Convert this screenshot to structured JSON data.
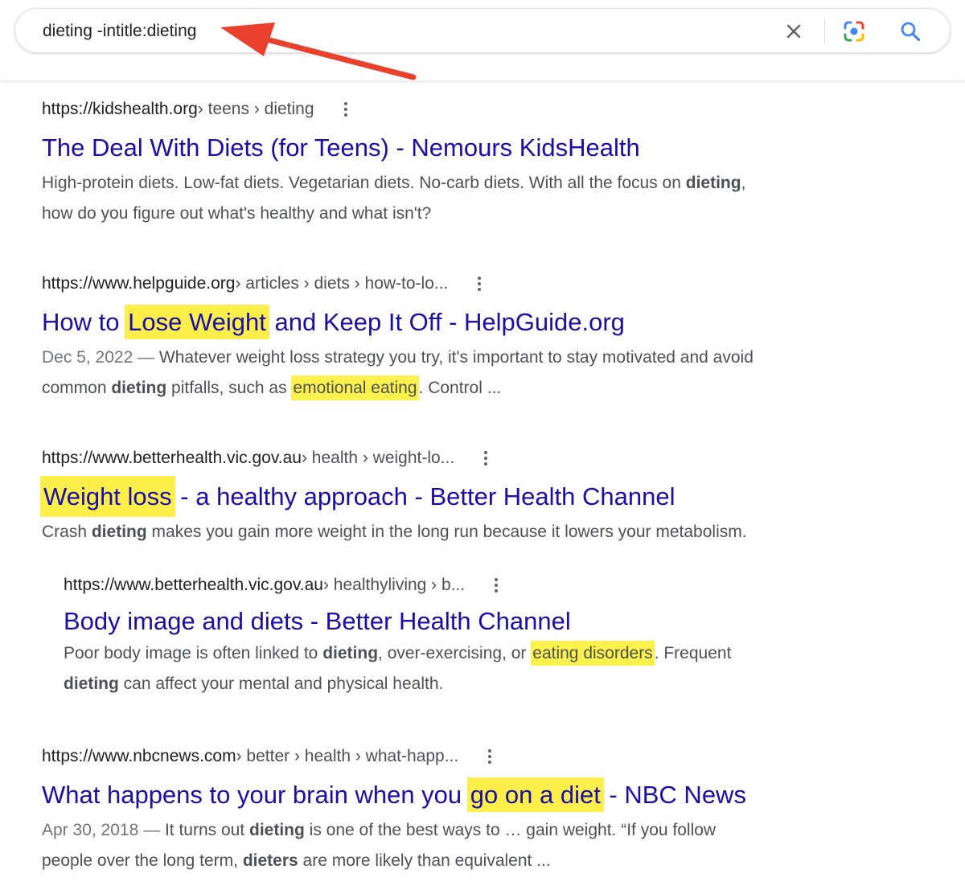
{
  "search": {
    "query": "dieting -intitle:dieting"
  },
  "icons": {
    "clear": "close-icon",
    "lens": "camera-lens-icon",
    "search": "search-icon",
    "more": "more-vert-icon"
  },
  "colors": {
    "link": "#1a0dab",
    "highlight": "#fcf14d",
    "arrow": "#e8422f"
  },
  "results": [
    {
      "domain": "https://kidshealth.org",
      "path": " › teens › dieting",
      "title": "The Deal With Diets (for Teens) - Nemours KidsHealth",
      "snippet": {
        "s1": "High-protein diets. Low-fat diets. Vegetarian diets. No-carb diets. With all the focus on ",
        "b1": "dieting",
        "s2": ",",
        "s3": "how do you figure out what's healthy and what isn't?"
      }
    },
    {
      "domain": "https://www.helpguide.org",
      "path": " › articles › diets › how-to-lo...",
      "title": {
        "pre": "How to ",
        "hl": "Lose Weight",
        "post": " and Keep It Off - HelpGuide.org"
      },
      "snippet": {
        "date": "Dec 5, 2022 — ",
        "s1": "Whatever weight loss strategy you try, it's important to stay motivated and avoid",
        "s2": "common ",
        "b1": "dieting",
        "s3": " pitfalls, such as ",
        "hl": "emotional eating",
        "s4": ". Control ..."
      }
    },
    {
      "domain": "https://www.betterhealth.vic.gov.au",
      "path": " › health › weight-lo...",
      "title": {
        "hl": "Weight loss",
        "post": " - a healthy approach - Better Health Channel"
      },
      "snippet": {
        "s1": "Crash ",
        "b1": "dieting",
        "s2": " makes you gain more weight in the long run because it lowers your metabolism."
      }
    },
    {
      "domain": "https://www.betterhealth.vic.gov.au",
      "path": " › healthyliving › b...",
      "title": "Body image and diets - Better Health Channel",
      "snippet": {
        "s1": "Poor body image is often linked to ",
        "b1": "dieting",
        "s2": ", over-exercising, or ",
        "hl": "eating disorders",
        "s3": ". Frequent",
        "b2": "dieting",
        "s4": " can affect your mental and physical health."
      }
    },
    {
      "domain": "https://www.nbcnews.com",
      "path": " › better › health › what-happ...",
      "title": {
        "pre": "What happens to your brain when you ",
        "hl": "go on a diet",
        "post": " - NBC News"
      },
      "snippet": {
        "date": "Apr 30, 2018 — ",
        "s1": "It turns out ",
        "b1": "dieting",
        "s2": " is one of the best ways to … gain weight. “If you follow",
        "s3": "people over the long term, ",
        "b2": "dieters",
        "s4": " are more likely than equivalent ..."
      }
    }
  ]
}
